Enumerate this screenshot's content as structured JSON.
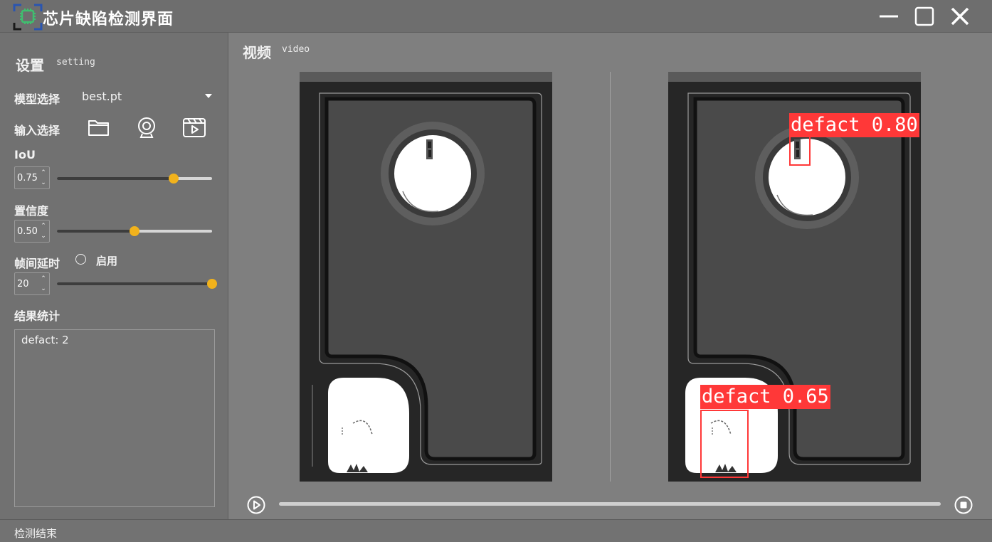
{
  "window": {
    "title": "芯片缺陷检测界面",
    "logo_icon": "chip-icon",
    "controls": [
      "minimize-icon",
      "maximize-icon",
      "close-icon"
    ]
  },
  "settings": {
    "title": "设置",
    "subtitle": "setting",
    "model": {
      "label": "模型选择",
      "value": "best.pt"
    },
    "input": {
      "label": "输入选择",
      "icons": [
        "folder-icon",
        "camera-icon",
        "video-icon"
      ]
    },
    "iou": {
      "label": "IoU",
      "value": "0.75",
      "level": 0.75
    },
    "confidence": {
      "label": "置信度",
      "value": "0.50",
      "level": 0.5
    },
    "frame_delay": {
      "label": "帧间延时",
      "enable_label": "启用",
      "enabled": false,
      "value": "20",
      "level": 1.0
    },
    "results": {
      "label": "结果统计",
      "text": "defact: 2"
    }
  },
  "video": {
    "title": "视频",
    "subtitle": "video",
    "detections": [
      {
        "label": "defact 0.80"
      },
      {
        "label": "defact 0.65"
      }
    ],
    "progress": 0.0
  },
  "colors": {
    "accent": "#f1b21c",
    "detection": "#ff3838"
  },
  "status": {
    "text": "检测结束"
  }
}
